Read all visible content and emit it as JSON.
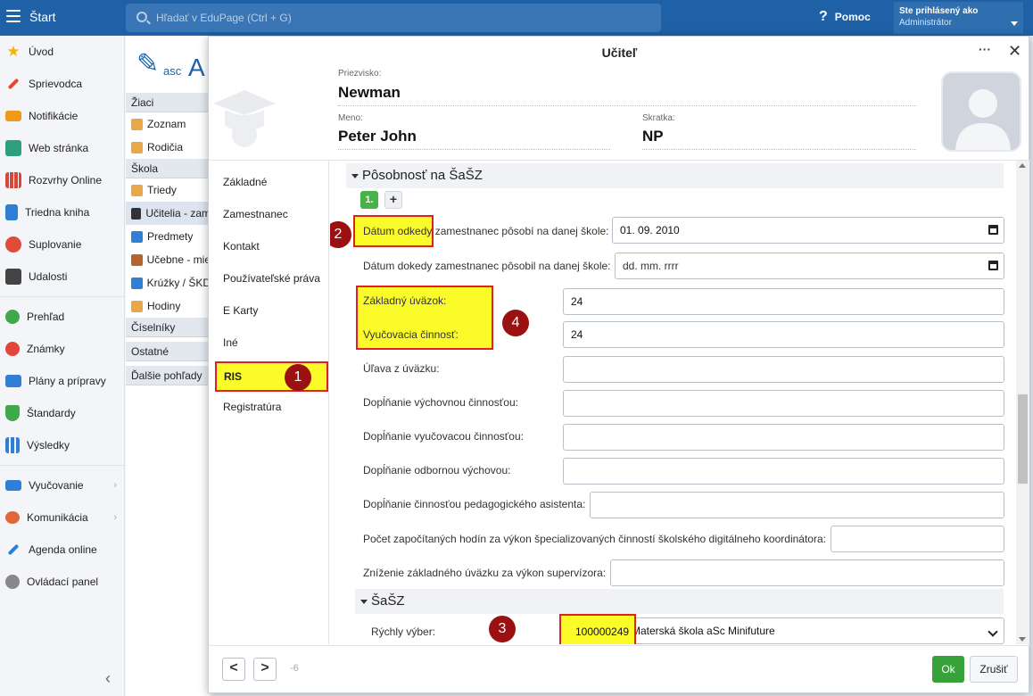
{
  "topbar": {
    "brand": "Štart",
    "search_placeholder": "Hľadať v EduPage (Ctrl + G)",
    "help": "Pomoc",
    "user_line1": "Ste prihlásený ako",
    "user_line2": "Administrátor"
  },
  "leftnav": {
    "items": [
      {
        "label": "Úvod",
        "icon": "star-icon",
        "color": "#f2b600"
      },
      {
        "label": "Sprievodca",
        "icon": "wand-icon",
        "color": "#e24a2b"
      },
      {
        "label": "Notifikácie",
        "icon": "envelope-icon",
        "color": "#f09a1a"
      },
      {
        "label": "Web stránka",
        "icon": "home-icon",
        "color": "#2f9e7a"
      },
      {
        "label": "Rozvrhy Online",
        "icon": "grid-icon",
        "color": "#d9473a"
      },
      {
        "label": "Triedna kniha",
        "icon": "book-icon",
        "color": "#2f7fd6"
      },
      {
        "label": "Suplovanie",
        "icon": "person-icon",
        "color": "#e04b3a"
      },
      {
        "label": "Udalosti",
        "icon": "calendar-icon",
        "color": "#444444"
      },
      {
        "label": "Prehľad",
        "icon": "check-circle-icon",
        "color": "#3eaa4b"
      },
      {
        "label": "Známky",
        "icon": "grade-icon",
        "color": "#e2463a"
      },
      {
        "label": "Plány a prípravy",
        "icon": "briefcase-icon",
        "color": "#2f7fd6"
      },
      {
        "label": "Štandardy",
        "icon": "shield-icon",
        "color": "#3eaa4b"
      },
      {
        "label": "Výsledky",
        "icon": "bar-chart-icon",
        "color": "#2f7fd6"
      },
      {
        "label": "Vyučovanie",
        "icon": "open-book-icon",
        "color": "#2f7fd6"
      },
      {
        "label": "Komunikácia",
        "icon": "chat-icon",
        "color": "#e2663a"
      },
      {
        "label": "Agenda online",
        "icon": "pen-icon",
        "color": "#2f7fd6"
      },
      {
        "label": "Ovládací panel",
        "icon": "gear-icon",
        "color": "#888888"
      }
    ]
  },
  "subnav": {
    "logo_small": "asc",
    "logo_big": "A",
    "groups": [
      {
        "head": "Žiaci",
        "items": [
          {
            "label": "Zoznam"
          },
          {
            "label": "Rodičia"
          }
        ]
      },
      {
        "head": "Škola",
        "items": [
          {
            "label": "Triedy"
          },
          {
            "label": "Učitelia - zam"
          },
          {
            "label": "Predmety"
          },
          {
            "label": "Učebne - mie"
          },
          {
            "label": "Krúžky / ŠKD"
          },
          {
            "label": "Hodiny"
          }
        ]
      },
      {
        "head": "Číselníky",
        "items": []
      },
      {
        "head": "Ostatné",
        "items": []
      },
      {
        "head": "Ďalšie pohľady",
        "items": []
      }
    ]
  },
  "modal": {
    "title": "Učiteľ",
    "more": "···",
    "close": "✕",
    "surname_label": "Priezvisko:",
    "surname": "Newman",
    "name_label": "Meno:",
    "name": "Peter John",
    "abbr_label": "Skratka:",
    "abbr": "NP",
    "tabs": [
      "Základné",
      "Zamestnanec",
      "Kontakt",
      "Používateľské práva",
      "E Karty",
      "Iné",
      "RIS",
      "Registratúra"
    ],
    "section1": "Pôsobnosť na ŠaŠZ",
    "tag1": "1.",
    "tag_plus": "+",
    "rows": {
      "date_from_label_a": "Dátum odkedy",
      "date_from_label_b": " zamestnanec pôsobí na danej škole:",
      "date_from_value": "01. 09. 2010",
      "date_to_label": "Dátum dokedy zamestnanec pôsobil na danej škole:",
      "date_to_value": "dd. mm. rrrr",
      "base_load_label": "Základný úväzok:",
      "base_load_value": "24",
      "teaching_label": "Vyučovacia činnosť:",
      "teaching_value": "24",
      "relief_label": "Úľava z úväzku:",
      "edu_label": "Dopĺňanie výchovnou činnosťou:",
      "teach_fill_label": "Dopĺňanie vyučovacou činnosťou:",
      "prof_label": "Dopĺňanie odbornou výchovou:",
      "assist_label": "Dopĺňanie činnosťou pedagogického asistenta:",
      "digital_label": "Počet započítaných hodín za výkon špecializovaných činností školského digitálneho koordinátora:",
      "supervisor_label": "Zníženie základného úväzku za výkon supervízora:"
    },
    "section2": "ŠaŠZ",
    "quick_label": "Rýchly výber:",
    "quick_code": "100000249",
    "quick_value": "Materská škola aSc Minifuture",
    "badges": [
      "1",
      "2",
      "3",
      "4"
    ],
    "prev": "<",
    "next": ">",
    "page": "-6",
    "ok": "Ok",
    "cancel": "Zrušiť"
  }
}
